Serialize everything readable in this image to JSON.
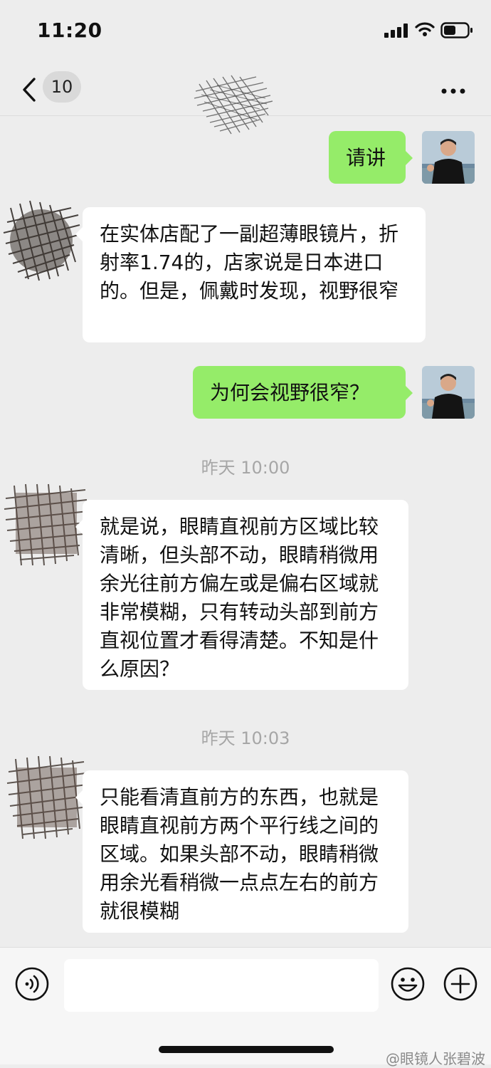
{
  "status_bar": {
    "time": "11:20"
  },
  "nav": {
    "back_count": "10",
    "more_label": "•••"
  },
  "messages": [
    {
      "from": "me",
      "text": "请讲"
    },
    {
      "from": "them",
      "text": "在实体店配了一副超薄眼镜片，折射率1.74的，店家说是日本进口的。但是，佩戴时发现，视野很窄"
    },
    {
      "from": "me",
      "text": "为何会视野很窄？"
    },
    {
      "from": "them",
      "text": "就是说，眼睛直视前方区域比较清晰，但头部不动，眼睛稍微用余光往前方偏左或是偏右区域就非常模糊，只有转动头部到前方直视位置才看得清楚。不知是什么原因？"
    },
    {
      "from": "them",
      "text": "只能看清直前方的东西，也就是眼睛直视前方两个平行线之间的区域。如果头部不动，眼睛稍微用余光看稍微一点点左右的前方就很模糊"
    }
  ],
  "timestamps": [
    "昨天 10:00",
    "昨天 10:03"
  ],
  "composer": {
    "input_value": ""
  },
  "watermark": "@眼镜人张碧波",
  "colors": {
    "me_bubble": "#95ec69",
    "them_bubble": "#ffffff",
    "background": "#ededed"
  }
}
